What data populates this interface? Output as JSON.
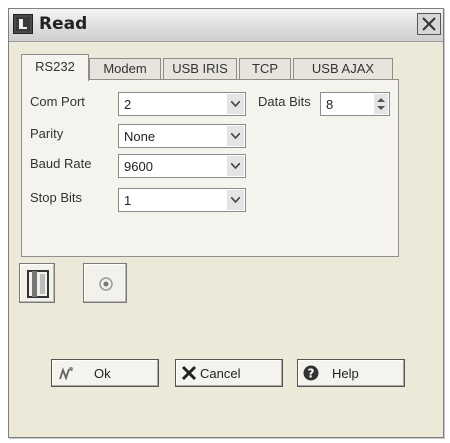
{
  "window": {
    "title": "Read",
    "app_icon": "read-app-icon",
    "close_icon": "close-icon"
  },
  "tabs": [
    {
      "label": "RS232",
      "active": true
    },
    {
      "label": "Modem",
      "active": false
    },
    {
      "label": "USB IRIS",
      "active": false
    },
    {
      "label": "TCP",
      "active": false
    },
    {
      "label": "USB AJAX",
      "active": false
    }
  ],
  "rs232": {
    "com_port": {
      "label": "Com Port",
      "value": "2"
    },
    "parity": {
      "label": "Parity",
      "value": "None"
    },
    "baud_rate": {
      "label": "Baud Rate",
      "value": "9600"
    },
    "stop_bits": {
      "label": "Stop Bits",
      "value": "1"
    },
    "data_bits": {
      "label": "Data Bits",
      "value": "8"
    }
  },
  "tool_buttons": {
    "first_icon": "device-icon",
    "second_icon": "radio-dot-icon"
  },
  "actions": {
    "ok_label": "Ok",
    "cancel_label": "Cancel",
    "help_label": "Help"
  }
}
